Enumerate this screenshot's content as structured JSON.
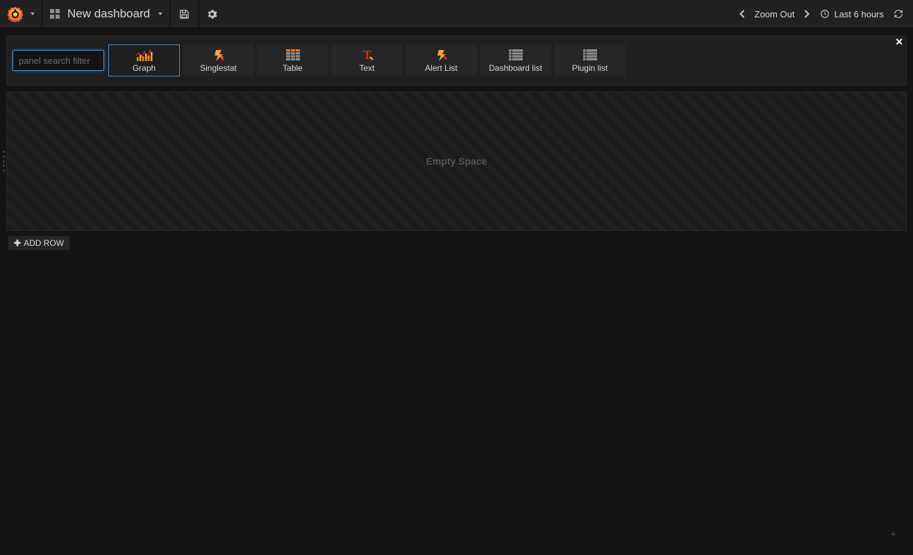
{
  "navbar": {
    "dashboard_title": "New dashboard",
    "zoom_out": "Zoom Out",
    "time_range": "Last 6 hours"
  },
  "picker": {
    "search_placeholder": "panel search filter",
    "tiles": [
      {
        "label": "Graph",
        "icon": "graph",
        "selected": true
      },
      {
        "label": "Singlestat",
        "icon": "singlestat",
        "selected": false
      },
      {
        "label": "Table",
        "icon": "table",
        "selected": false
      },
      {
        "label": "Text",
        "icon": "text",
        "selected": false
      },
      {
        "label": "Alert List",
        "icon": "alert",
        "selected": false
      },
      {
        "label": "Dashboard list",
        "icon": "dashlist",
        "selected": false
      },
      {
        "label": "Plugin list",
        "icon": "pluglist",
        "selected": false
      }
    ]
  },
  "row": {
    "empty_label": "Empty Space"
  },
  "buttons": {
    "add_row": "ADD ROW"
  }
}
